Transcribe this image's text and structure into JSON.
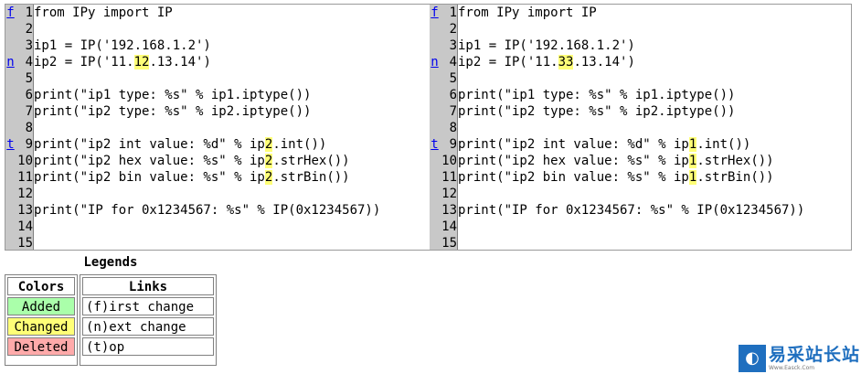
{
  "left": {
    "lines": [
      {
        "n": "1",
        "nav": "f",
        "segments": [
          {
            "t": "from IPy import IP"
          }
        ]
      },
      {
        "n": "2",
        "segments": []
      },
      {
        "n": "3",
        "segments": [
          {
            "t": "ip1 = IP('192.168.1.2')"
          }
        ]
      },
      {
        "n": "4",
        "nav": "n",
        "segments": [
          {
            "t": "ip2 = IP('11."
          },
          {
            "t": "12",
            "c": 1
          },
          {
            "t": ".13.14')"
          }
        ]
      },
      {
        "n": "5",
        "segments": []
      },
      {
        "n": "6",
        "segments": [
          {
            "t": "print(\"ip1 type: %s\" % ip1.iptype())"
          }
        ]
      },
      {
        "n": "7",
        "segments": [
          {
            "t": "print(\"ip2 type: %s\" % ip2.iptype())"
          }
        ]
      },
      {
        "n": "8",
        "segments": []
      },
      {
        "n": "9",
        "nav": "t",
        "segments": [
          {
            "t": "print(\"ip2 int value: %d\" % ip"
          },
          {
            "t": "2",
            "c": 1
          },
          {
            "t": ".int())"
          }
        ]
      },
      {
        "n": "10",
        "segments": [
          {
            "t": "print(\"ip2 hex value: %s\" % ip"
          },
          {
            "t": "2",
            "c": 1
          },
          {
            "t": ".strHex())"
          }
        ]
      },
      {
        "n": "11",
        "segments": [
          {
            "t": "print(\"ip2 bin value: %s\" % ip"
          },
          {
            "t": "2",
            "c": 1
          },
          {
            "t": ".strBin())"
          }
        ]
      },
      {
        "n": "12",
        "segments": []
      },
      {
        "n": "13",
        "segments": [
          {
            "t": "print(\"IP for 0x1234567: %s\" % IP(0x1234567))"
          }
        ]
      },
      {
        "n": "14",
        "segments": []
      },
      {
        "n": "15",
        "segments": []
      }
    ]
  },
  "right": {
    "lines": [
      {
        "n": "1",
        "nav": "f",
        "segments": [
          {
            "t": "from IPy import IP"
          }
        ]
      },
      {
        "n": "2",
        "segments": []
      },
      {
        "n": "3",
        "segments": [
          {
            "t": "ip1 = IP('192.168.1.2')"
          }
        ]
      },
      {
        "n": "4",
        "nav": "n",
        "segments": [
          {
            "t": "ip2 = IP('11."
          },
          {
            "t": "33",
            "c": 1
          },
          {
            "t": ".13.14')"
          }
        ]
      },
      {
        "n": "5",
        "segments": []
      },
      {
        "n": "6",
        "segments": [
          {
            "t": "print(\"ip1 type: %s\" % ip1.iptype())"
          }
        ]
      },
      {
        "n": "7",
        "segments": [
          {
            "t": "print(\"ip2 type: %s\" % ip2.iptype())"
          }
        ]
      },
      {
        "n": "8",
        "segments": []
      },
      {
        "n": "9",
        "nav": "t",
        "segments": [
          {
            "t": "print(\"ip2 int value: %d\" % ip"
          },
          {
            "t": "1",
            "c": 1
          },
          {
            "t": ".int())"
          }
        ]
      },
      {
        "n": "10",
        "segments": [
          {
            "t": "print(\"ip2 hex value: %s\" % ip"
          },
          {
            "t": "1",
            "c": 1
          },
          {
            "t": ".strHex())"
          }
        ]
      },
      {
        "n": "11",
        "segments": [
          {
            "t": "print(\"ip2 bin value: %s\" % ip"
          },
          {
            "t": "1",
            "c": 1
          },
          {
            "t": ".strBin())"
          }
        ]
      },
      {
        "n": "12",
        "segments": []
      },
      {
        "n": "13",
        "segments": [
          {
            "t": "print(\"IP for 0x1234567: %s\" % IP(0x1234567))"
          }
        ]
      },
      {
        "n": "14",
        "segments": []
      },
      {
        "n": "15",
        "segments": []
      }
    ]
  },
  "legend": {
    "title": "Legends",
    "colors_header": "Colors",
    "links_header": "Links",
    "colors": {
      "added": "Added",
      "changed": "Changed",
      "deleted": "Deleted"
    },
    "links": {
      "first": "(f)irst change",
      "next": "(n)ext change",
      "top": "(t)op"
    }
  },
  "logo": {
    "text": "易采站长站",
    "sub": "Www.Easck.Com"
  },
  "palette": {
    "added": "#aaffaa",
    "changed": "#ffff77",
    "deleted": "#ffaaaa",
    "link": "#0000ee",
    "gutter": "#c8c8c8",
    "logo": "#1f6fbf"
  }
}
